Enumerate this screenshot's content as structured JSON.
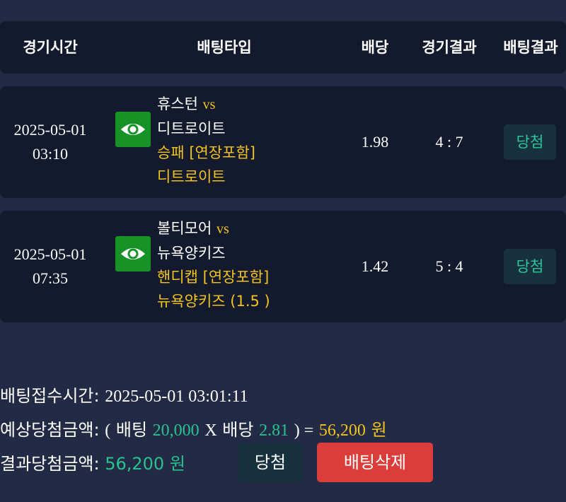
{
  "header": {
    "col_time": "경기시간",
    "col_bet_type": "배팅타입",
    "col_odds": "배당",
    "col_game_result": "경기결과",
    "col_bet_result": "배팅결과"
  },
  "bets": [
    {
      "date": "2025-05-01",
      "time": "03:10",
      "home": "휴스턴",
      "vs": "vs",
      "away": "디트로이트",
      "market": "승패 [연장포함]",
      "pick": "디트로이트",
      "odds": "1.98",
      "score": "4 : 7",
      "result": "당첨"
    },
    {
      "date": "2025-05-01",
      "time": "07:35",
      "home": "볼티모어",
      "vs": "vs",
      "away": "뉴욕양키즈",
      "market": "핸디캡 [연장포함]",
      "pick": "뉴욕양키즈 (1.5 )",
      "odds": "1.42",
      "score": "5 : 4",
      "result": "당첨"
    }
  ],
  "summary": {
    "received_label": "배팅접수시간:",
    "received_value": "2025-05-01 03:01:11",
    "expected_label": "예상당첨금액:",
    "open_paren": "(",
    "bet_label": "배팅",
    "bet_amount": "20,000",
    "times": "X",
    "odds_label": "배당",
    "total_odds": "2.81",
    "close_eq": ") =",
    "expected_amount": "56,200",
    "won": "원",
    "result_label": "결과당첨금액:",
    "result_amount": "56,200 원"
  },
  "buttons": {
    "win": "당첨",
    "delete": "배팅삭제"
  },
  "colors": {
    "background": "#232a45",
    "panel": "#141a2d",
    "accent_yellow": "#f2c31b",
    "accent_green": "#29c28f",
    "eye_button": "#179227",
    "delete_button": "#db3d3a"
  }
}
